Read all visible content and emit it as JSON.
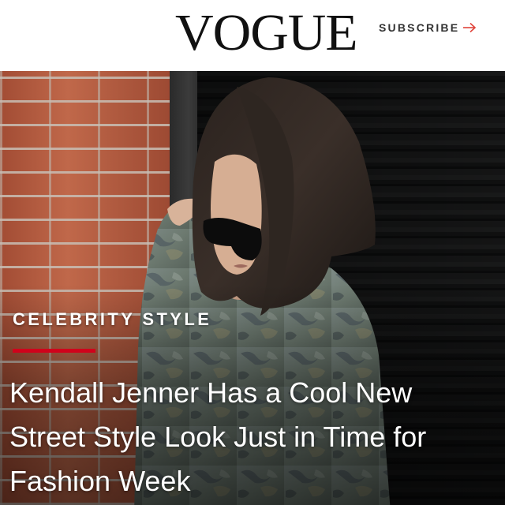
{
  "header": {
    "logo": "VOGUE",
    "subscribe_label": "SUBSCRIBE"
  },
  "article": {
    "category": "CELEBRITY STYLE",
    "headline": "Kendall Jenner Has a Cool New Street Style Look Just in Time for Fashion Week"
  },
  "colors": {
    "accent_rule": "#d0021b",
    "subscribe_arrow": "#e0443b"
  },
  "icons": {
    "subscribe_arrow": "arrow-right-icon"
  }
}
